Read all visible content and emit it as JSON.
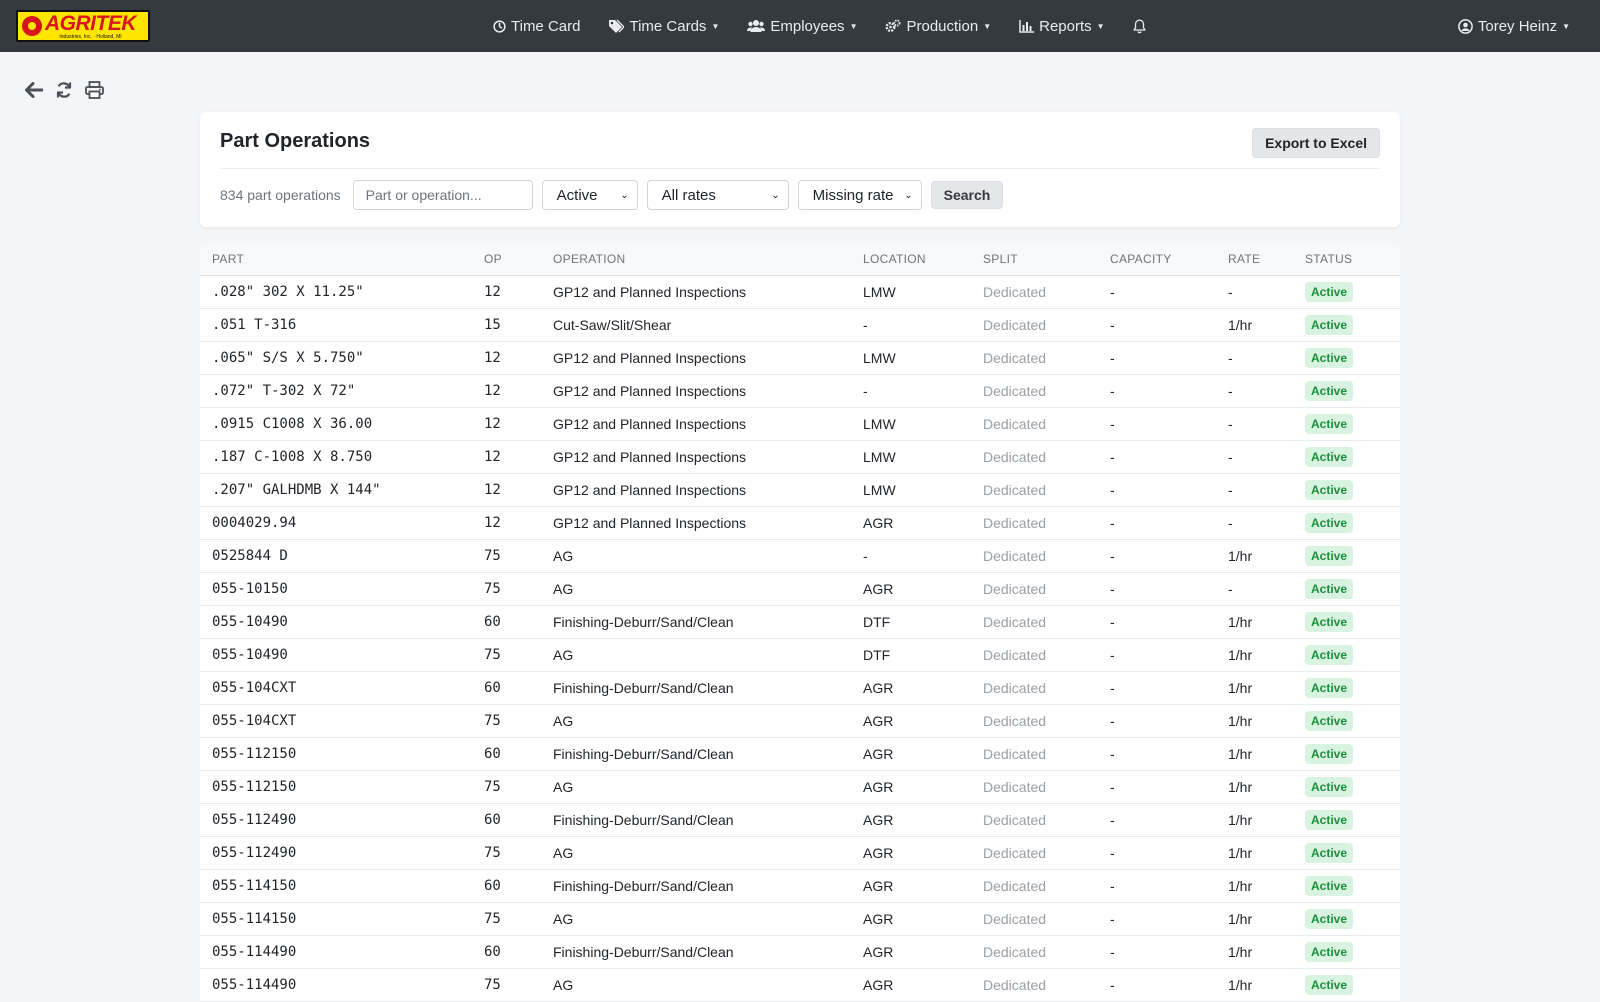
{
  "brand": {
    "name": "AGRITEK",
    "tagline": "Industries, Inc. · Holland, MI"
  },
  "nav": {
    "time_card": "Time Card",
    "time_cards": "Time Cards",
    "employees": "Employees",
    "production": "Production",
    "reports": "Reports",
    "user": "Torey Heinz"
  },
  "page": {
    "title": "Part Operations",
    "export_label": "Export to Excel"
  },
  "filters": {
    "count": "834 part operations",
    "search_placeholder": "Part or operation...",
    "status": "Active",
    "rates": "All rates",
    "missing": "Missing rate",
    "search_label": "Search"
  },
  "table": {
    "columns": [
      "PART",
      "OP",
      "OPERATION",
      "LOCATION",
      "SPLIT",
      "CAPACITY",
      "RATE",
      "STATUS"
    ],
    "rows": [
      [
        ".028\" 302 X 11.25\"",
        "12",
        "GP12 and Planned Inspections",
        "LMW",
        "Dedicated",
        "-",
        "-",
        "Active"
      ],
      [
        ".051 T-316",
        "15",
        "Cut-Saw/Slit/Shear",
        "-",
        "Dedicated",
        "-",
        "1/hr",
        "Active"
      ],
      [
        ".065\" S/S X 5.750\"",
        "12",
        "GP12 and Planned Inspections",
        "LMW",
        "Dedicated",
        "-",
        "-",
        "Active"
      ],
      [
        ".072\" T-302 X 72\"",
        "12",
        "GP12 and Planned Inspections",
        "-",
        "Dedicated",
        "-",
        "-",
        "Active"
      ],
      [
        ".0915 C1008 X 36.00",
        "12",
        "GP12 and Planned Inspections",
        "LMW",
        "Dedicated",
        "-",
        "-",
        "Active"
      ],
      [
        ".187 C-1008 X 8.750",
        "12",
        "GP12 and Planned Inspections",
        "LMW",
        "Dedicated",
        "-",
        "-",
        "Active"
      ],
      [
        ".207\" GALHDMB X 144\"",
        "12",
        "GP12 and Planned Inspections",
        "LMW",
        "Dedicated",
        "-",
        "-",
        "Active"
      ],
      [
        "0004029.94",
        "12",
        "GP12 and Planned Inspections",
        "AGR",
        "Dedicated",
        "-",
        "-",
        "Active"
      ],
      [
        "0525844 D",
        "75",
        "AG",
        "-",
        "Dedicated",
        "-",
        "1/hr",
        "Active"
      ],
      [
        "055-10150",
        "75",
        "AG",
        "AGR",
        "Dedicated",
        "-",
        "-",
        "Active"
      ],
      [
        "055-10490",
        "60",
        "Finishing-Deburr/Sand/Clean",
        "DTF",
        "Dedicated",
        "-",
        "1/hr",
        "Active"
      ],
      [
        "055-10490",
        "75",
        "AG",
        "DTF",
        "Dedicated",
        "-",
        "1/hr",
        "Active"
      ],
      [
        "055-104CXT",
        "60",
        "Finishing-Deburr/Sand/Clean",
        "AGR",
        "Dedicated",
        "-",
        "1/hr",
        "Active"
      ],
      [
        "055-104CXT",
        "75",
        "AG",
        "AGR",
        "Dedicated",
        "-",
        "1/hr",
        "Active"
      ],
      [
        "055-112150",
        "60",
        "Finishing-Deburr/Sand/Clean",
        "AGR",
        "Dedicated",
        "-",
        "1/hr",
        "Active"
      ],
      [
        "055-112150",
        "75",
        "AG",
        "AGR",
        "Dedicated",
        "-",
        "1/hr",
        "Active"
      ],
      [
        "055-112490",
        "60",
        "Finishing-Deburr/Sand/Clean",
        "AGR",
        "Dedicated",
        "-",
        "1/hr",
        "Active"
      ],
      [
        "055-112490",
        "75",
        "AG",
        "AGR",
        "Dedicated",
        "-",
        "1/hr",
        "Active"
      ],
      [
        "055-114150",
        "60",
        "Finishing-Deburr/Sand/Clean",
        "AGR",
        "Dedicated",
        "-",
        "1/hr",
        "Active"
      ],
      [
        "055-114150",
        "75",
        "AG",
        "AGR",
        "Dedicated",
        "-",
        "1/hr",
        "Active"
      ],
      [
        "055-114490",
        "60",
        "Finishing-Deburr/Sand/Clean",
        "AGR",
        "Dedicated",
        "-",
        "1/hr",
        "Active"
      ],
      [
        "055-114490",
        "75",
        "AG",
        "AGR",
        "Dedicated",
        "-",
        "1/hr",
        "Active"
      ]
    ]
  },
  "colors": {
    "navbar": "#343a40",
    "badge_bg": "#d8f3df",
    "badge_text": "#1e8e3e",
    "logo_bg": "#ffe600",
    "logo_red": "#d6161c"
  },
  "icons": [
    "clock-icon",
    "tags-icon",
    "users-icon",
    "gears-icon",
    "bar-chart-icon",
    "bell-icon",
    "user-circle-icon",
    "back-arrow-icon",
    "refresh-icon",
    "print-icon"
  ]
}
